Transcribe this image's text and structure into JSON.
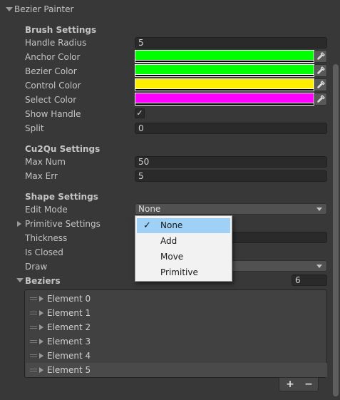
{
  "header": {
    "title": "Bezier Painter"
  },
  "brush": {
    "heading": "Brush Settings",
    "handle_radius": {
      "label": "Handle Radius",
      "value": "5"
    },
    "anchor_color": {
      "label": "Anchor Color",
      "color": "#00ff00"
    },
    "bezier_color": {
      "label": "Bezier Color",
      "color": "#00ff00"
    },
    "control_color": {
      "label": "Control Color",
      "color": "#ffee00"
    },
    "select_color": {
      "label": "Select Color",
      "color": "#ff00ff"
    },
    "show_handle": {
      "label": "Show Handle",
      "checked": true,
      "check_glyph": "✓"
    },
    "split": {
      "label": "Split",
      "value": "0"
    }
  },
  "cu2qu": {
    "heading": "Cu2Qu Settings",
    "max_num": {
      "label": "Max Num",
      "value": "50"
    },
    "max_err": {
      "label": "Max Err",
      "value": "5"
    }
  },
  "shape": {
    "heading": "Shape Settings",
    "edit_mode": {
      "label": "Edit Mode",
      "value": "None"
    },
    "primitive_settings": {
      "label": "Primitive Settings"
    },
    "thickness": {
      "label": "Thickness"
    },
    "is_closed": {
      "label": "Is Closed"
    },
    "draw": {
      "label": "Draw"
    }
  },
  "beziers": {
    "label": "Beziers",
    "size": "6",
    "elements": [
      "Element 0",
      "Element 1",
      "Element 2",
      "Element 3",
      "Element 4",
      "Element 5"
    ],
    "add_label": "+",
    "remove_label": "−"
  },
  "edit_mode_menu": {
    "options": [
      "None",
      "Add",
      "Move",
      "Primitive"
    ],
    "selected": "None",
    "check_glyph": "✓"
  }
}
